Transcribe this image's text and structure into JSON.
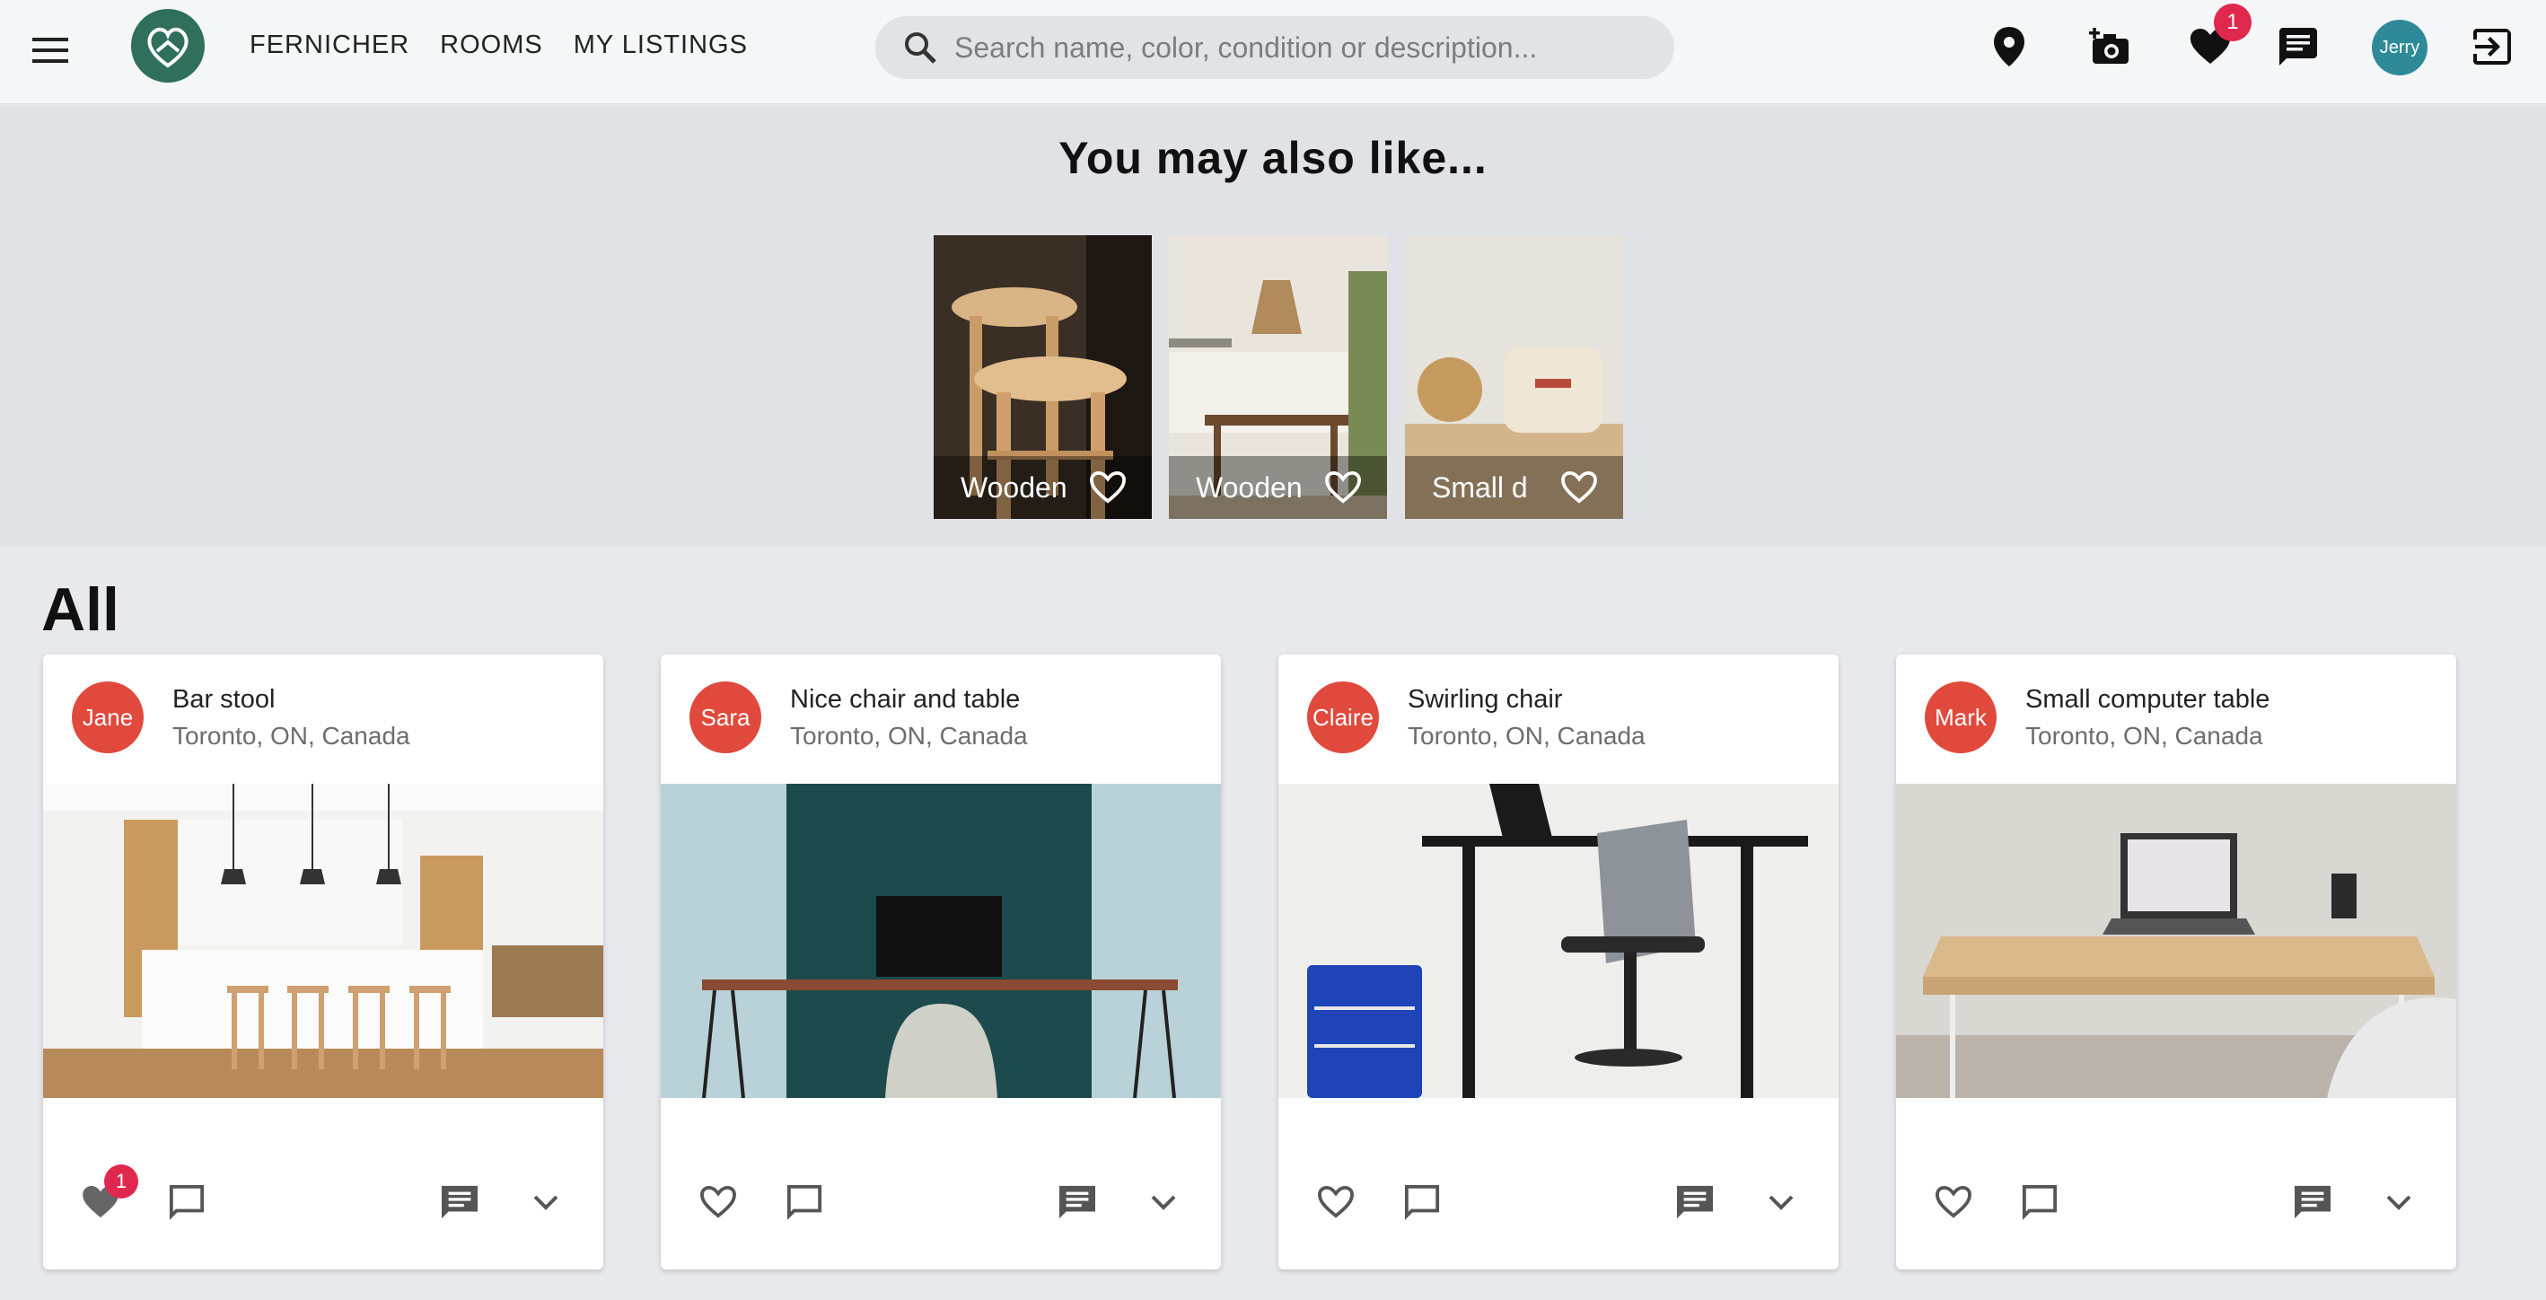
{
  "header": {
    "brand": "FERNICHER",
    "nav": [
      "ROOMS",
      "MY LISTINGS"
    ],
    "search_placeholder": "Search name, color, condition or description...",
    "favorites_badge": "1",
    "user_avatar": "Jerry",
    "icons": [
      "menu-icon",
      "logo-icon",
      "search-icon",
      "location-pin-icon",
      "add-photo-icon",
      "heart-icon",
      "chat-icon",
      "logout-icon"
    ]
  },
  "suggestions": {
    "heading": "You may also like...",
    "items": [
      {
        "label": "Wooden"
      },
      {
        "label": "Wooden"
      },
      {
        "label": "Small d"
      }
    ]
  },
  "all": {
    "heading": "All",
    "cards": [
      {
        "avatar": "Jane",
        "title": "Bar stool",
        "location": "Toronto, ON, Canada",
        "like_badge": "1"
      },
      {
        "avatar": "Sara",
        "title": "Nice chair and table",
        "location": "Toronto, ON, Canada",
        "like_badge": ""
      },
      {
        "avatar": "Claire",
        "title": "Swirling chair",
        "location": "Toronto, ON, Canada",
        "like_badge": ""
      },
      {
        "avatar": "Mark",
        "title": "Small computer table",
        "location": "Toronto, ON, Canada",
        "like_badge": ""
      }
    ]
  },
  "colors": {
    "accent_badge": "#e0284e",
    "avatar_red": "#e0493c",
    "avatar_teal": "#2e8a99",
    "logo_green": "#2f6f5c"
  }
}
